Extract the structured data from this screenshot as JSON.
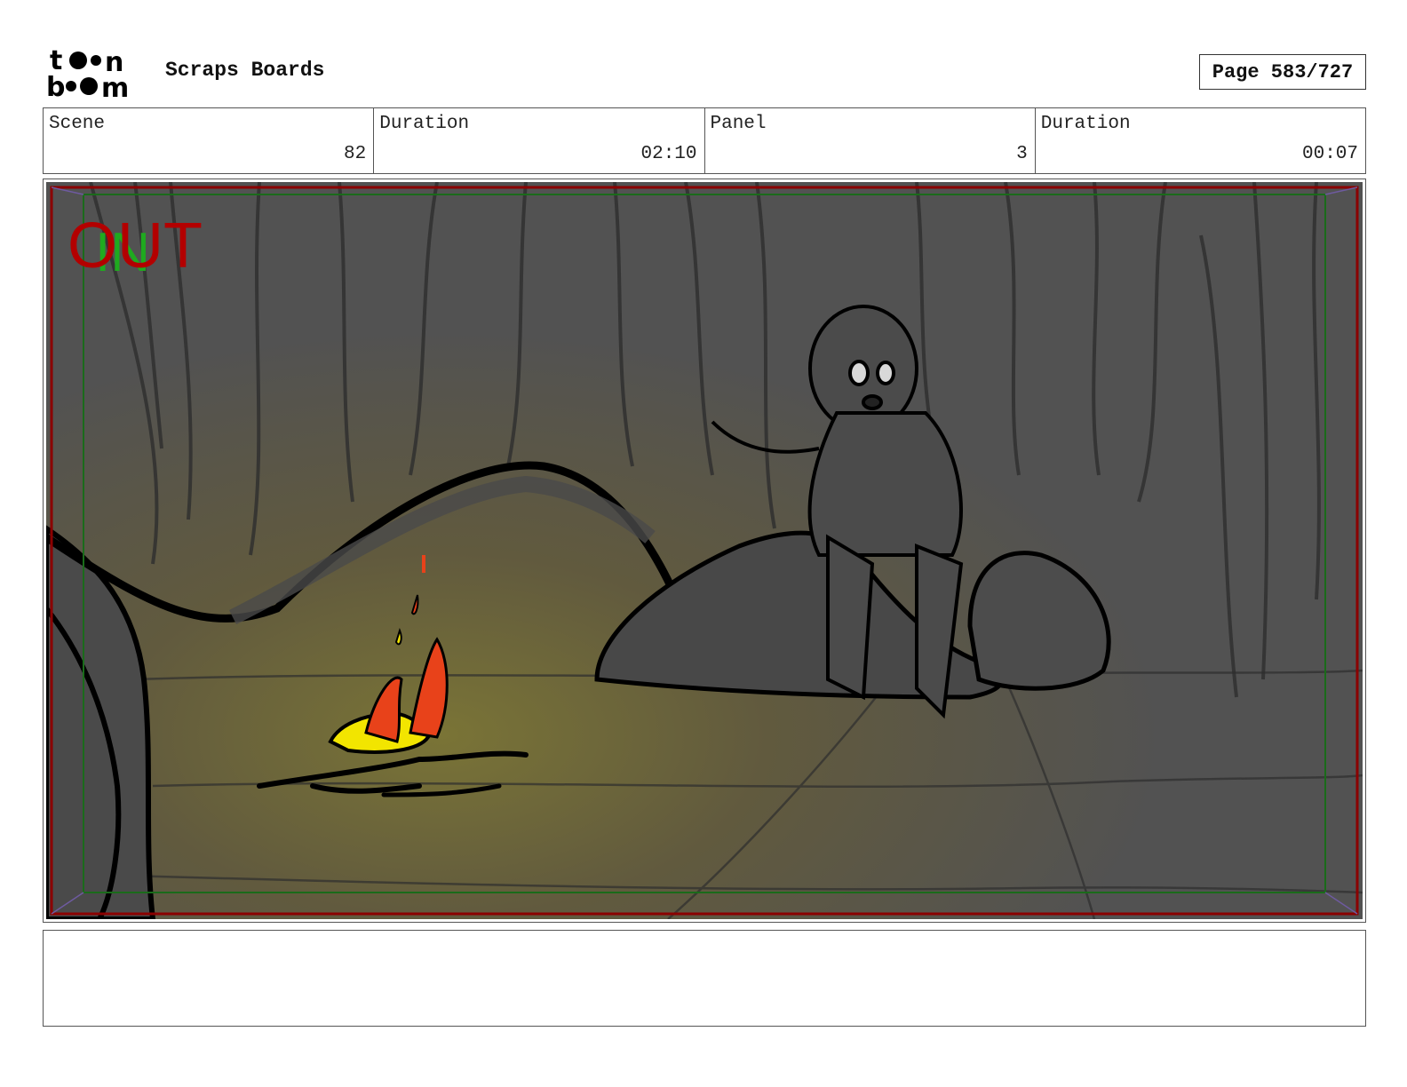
{
  "header": {
    "project_title": "Scraps Boards",
    "page_label": "Page 583/727"
  },
  "info": {
    "scene_label": "Scene",
    "scene_value": "82",
    "scene_duration_label": "Duration",
    "scene_duration_value": "02:10",
    "panel_label": "Panel",
    "panel_value": "3",
    "panel_duration_label": "Duration",
    "panel_duration_value": "00:07"
  },
  "panel": {
    "overlay_out": "OUT",
    "overlay_in": "IN",
    "safe_frame_color": "#8b0000",
    "title_safe_color": "#1a6b1a"
  },
  "notes": {
    "text": ""
  },
  "logo": {
    "text_top": "toon",
    "text_bottom": "boom"
  }
}
